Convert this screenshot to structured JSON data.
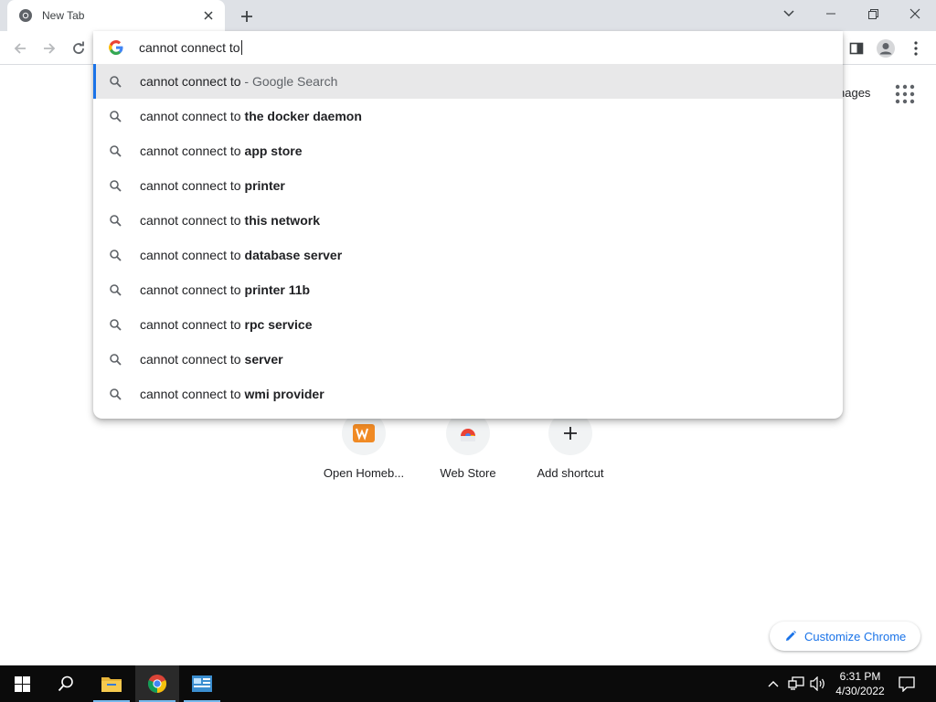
{
  "window": {
    "tab_title": "New Tab",
    "tab_favicon": "chrome-icon",
    "controls": [
      "chevron-down-icon",
      "minimize-icon",
      "restore-icon",
      "close-icon"
    ]
  },
  "toolbar": {
    "buttons": [
      "back-icon",
      "forward-icon",
      "reload-icon"
    ],
    "right_buttons": [
      "side-panel-icon",
      "profile-icon",
      "kebab-menu-icon"
    ]
  },
  "omnibox": {
    "value": "cannot connect to",
    "suggestions": [
      {
        "base": "cannot connect to",
        "desc": " - Google Search",
        "bold": ""
      },
      {
        "base": "cannot connect to",
        "bold": "the docker daemon",
        "desc": ""
      },
      {
        "base": "cannot connect to",
        "bold": "app store",
        "desc": ""
      },
      {
        "base": "cannot connect to",
        "bold": "printer",
        "desc": ""
      },
      {
        "base": "cannot connect to",
        "bold": "this network",
        "desc": ""
      },
      {
        "base": "cannot connect to",
        "bold": "database server",
        "desc": ""
      },
      {
        "base": "cannot connect to",
        "bold": "printer 11b",
        "desc": ""
      },
      {
        "base": "cannot connect to",
        "bold": "rpc service",
        "desc": ""
      },
      {
        "base": "cannot connect to",
        "bold": "server",
        "desc": ""
      },
      {
        "base": "cannot connect to",
        "bold": "wmi provider",
        "desc": ""
      }
    ]
  },
  "ntp": {
    "images_link": "nages",
    "shortcuts": [
      {
        "label": "Open Homeb...",
        "icon": "homebrew-icon"
      },
      {
        "label": "Web Store",
        "icon": "web-store-icon"
      },
      {
        "label": "Add shortcut",
        "icon": "plus-icon"
      }
    ],
    "customize_label": "Customize Chrome"
  },
  "taskbar": {
    "apps": [
      "start-icon",
      "search-icon",
      "file-explorer-icon",
      "chrome-icon",
      "control-panel-icon"
    ],
    "tray": [
      "chevron-up-icon",
      "network-icon",
      "volume-icon"
    ],
    "time": "6:31 PM",
    "date": "4/30/2022",
    "notification_icon": "notification-icon"
  },
  "colors": {
    "accent": "#1a73e8",
    "tabstrip": "#dee1e6",
    "selected_row": "#e8e8e9",
    "taskbar": "#0b0b0b"
  }
}
